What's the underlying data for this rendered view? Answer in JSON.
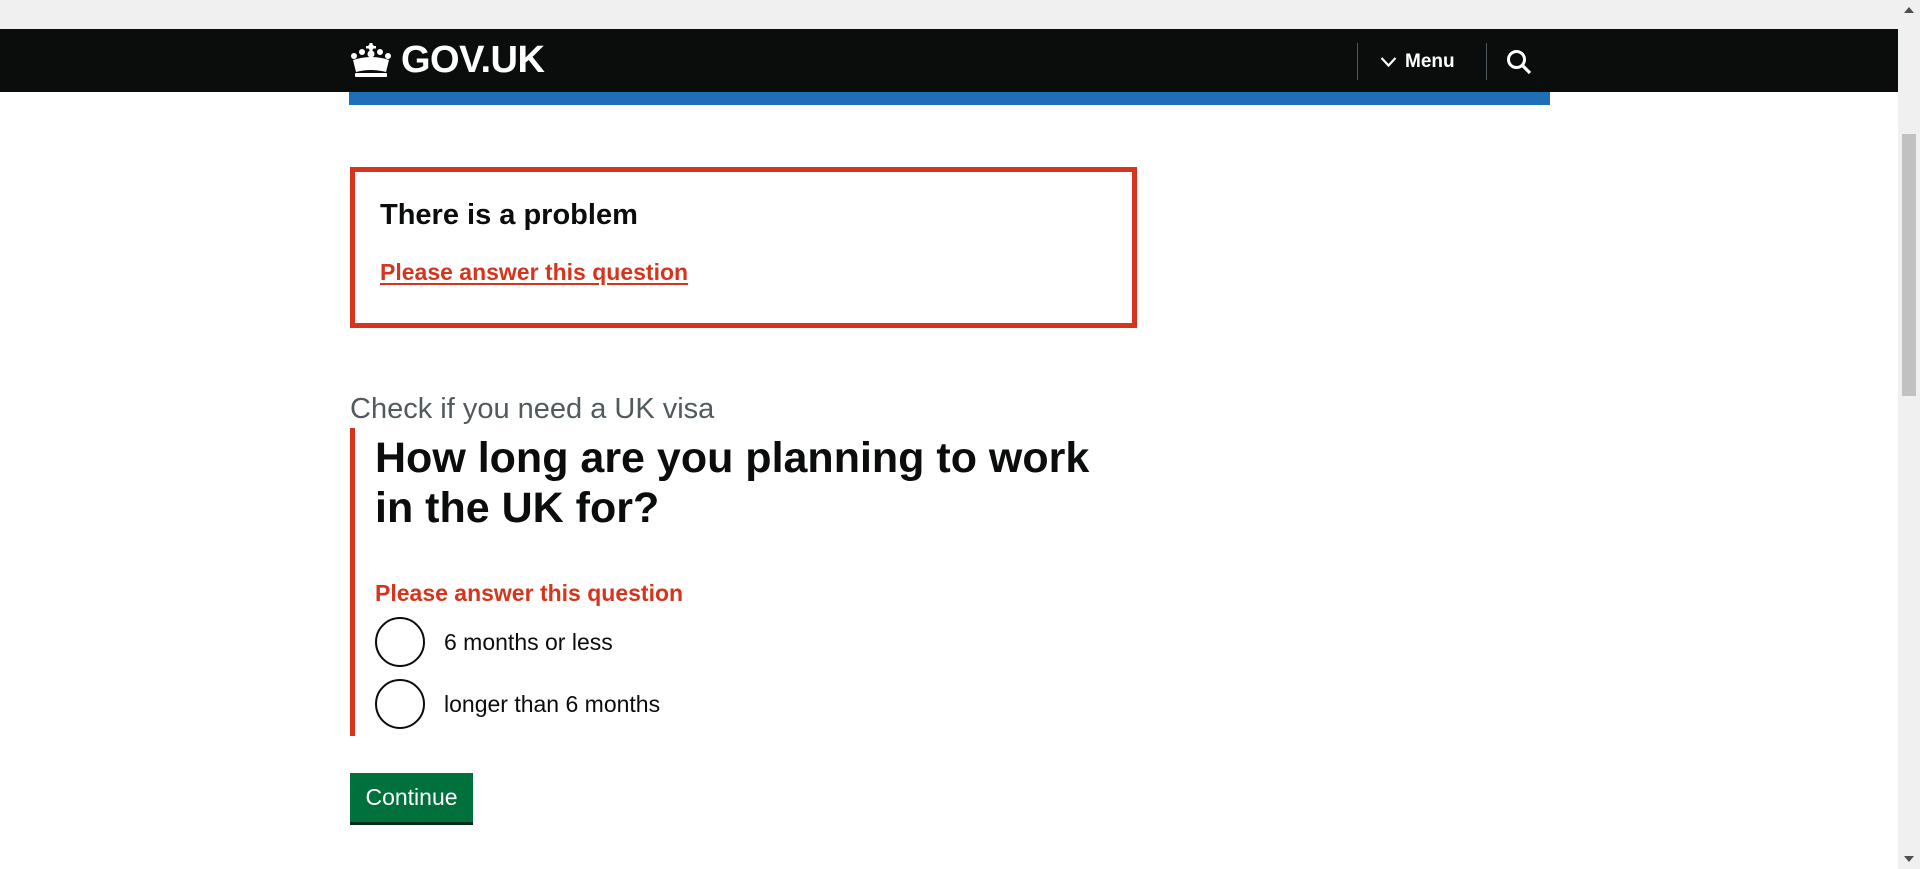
{
  "header": {
    "logo_text": "GOV.UK",
    "menu_label": "Menu",
    "search_icon": "search-icon",
    "menu_icon": "chevron-down-icon",
    "logo_icon": "crown-icon"
  },
  "error_summary": {
    "title": "There is a problem",
    "link": "Please answer this question"
  },
  "question": {
    "caption": "Check if you need a UK visa",
    "heading": "How long are you planning to work in the UK for?",
    "error_message": "Please answer this question",
    "options": [
      {
        "label": "6 months or less",
        "selected": false
      },
      {
        "label": "longer than 6 months",
        "selected": false
      }
    ]
  },
  "continue_label": "Continue",
  "colors": {
    "header_bg": "#0b0c0c",
    "brand_blue": "#1d70b8",
    "error_red": "#d4351c",
    "button_green": "#00703c",
    "caption_grey": "#505a5f"
  }
}
